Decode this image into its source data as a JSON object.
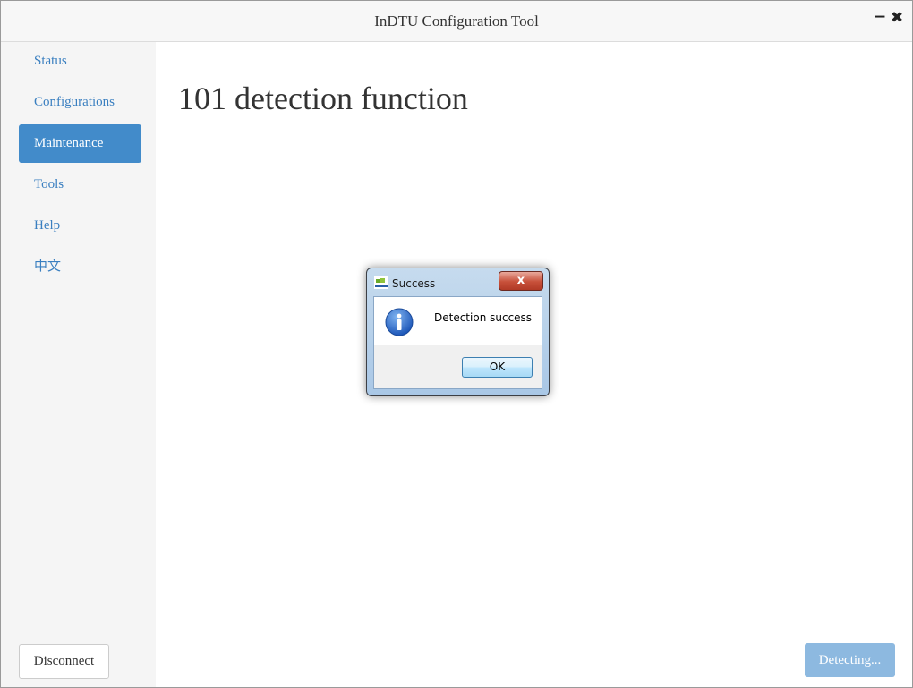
{
  "window": {
    "title": "InDTU Configuration Tool",
    "minimize_icon": "minimize-icon",
    "close_icon": "close-icon"
  },
  "sidebar": {
    "items": [
      {
        "label": "Status",
        "active": false
      },
      {
        "label": "Configurations",
        "active": false
      },
      {
        "label": "Maintenance",
        "active": true
      },
      {
        "label": "Tools",
        "active": false
      },
      {
        "label": "Help",
        "active": false
      },
      {
        "label": "中文",
        "active": false
      }
    ],
    "disconnect_label": "Disconnect"
  },
  "main": {
    "page_title": "101 detection function",
    "detecting_label": "Detecting..."
  },
  "dialog": {
    "title": "Success",
    "message": "Detection success",
    "ok_label": "OK",
    "close_label": "x",
    "icon": "info-icon"
  },
  "colors": {
    "accent": "#428bca",
    "link": "#3a7fc0",
    "detecting_button": "#8db9e0"
  }
}
